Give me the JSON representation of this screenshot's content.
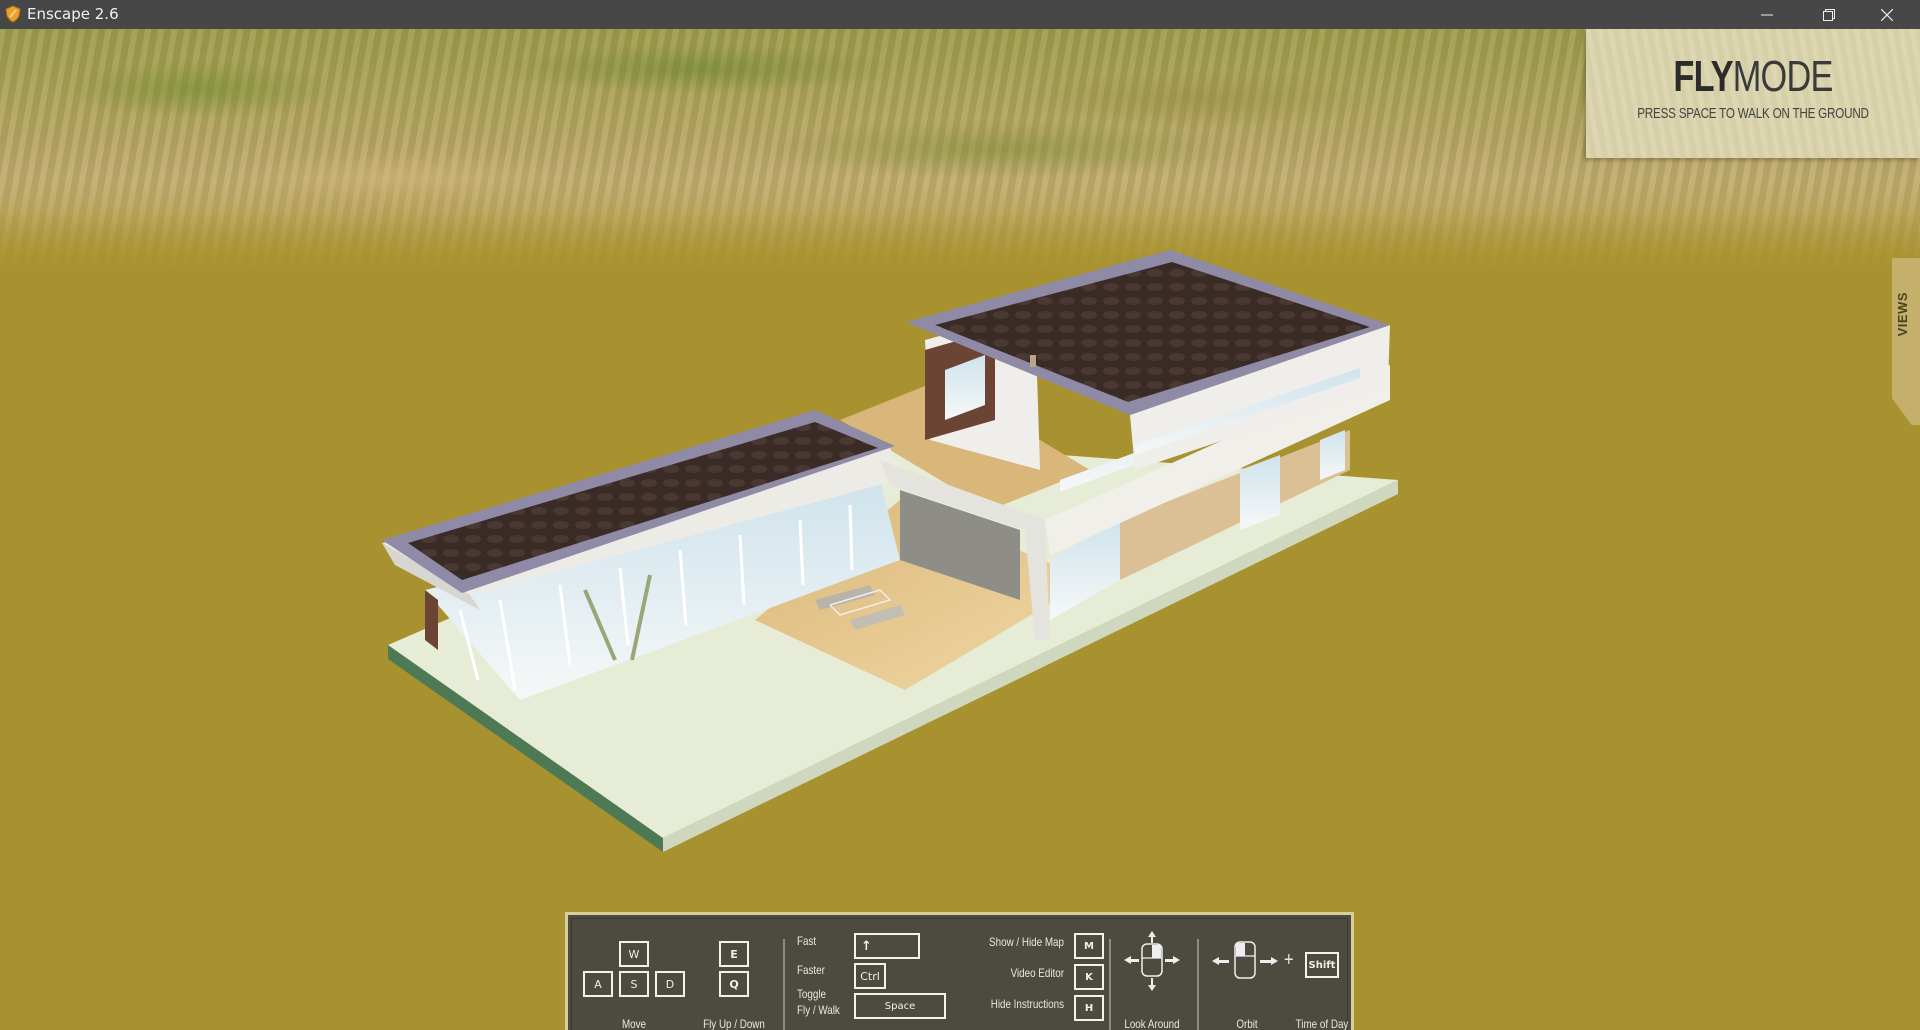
{
  "window": {
    "title": "Enscape 2.6",
    "controls": {
      "minimize": "minimize-icon",
      "restore": "restore-icon",
      "close": "close-icon"
    }
  },
  "overlay": {
    "mode_bold": "FLY",
    "mode_light": "MODE",
    "hint": "PRESS SPACE TO WALK ON THE GROUND",
    "views_tab": "VIEWS"
  },
  "instructions": {
    "move": {
      "keys": [
        "W",
        "A",
        "S",
        "D"
      ],
      "label": "Move"
    },
    "fly": {
      "keys": [
        "E",
        "Q"
      ],
      "label": "Fly Up / Down"
    },
    "fast": {
      "label": "Fast",
      "key": "↑",
      "key_icon": "shift-arrow-icon"
    },
    "faster": {
      "label": "Faster",
      "key": "Ctrl"
    },
    "toggle": {
      "label_line1": "Toggle",
      "label_line2": "Fly / Walk",
      "key": "Space"
    },
    "map": {
      "label": "Show / Hide Map",
      "key": "M"
    },
    "video": {
      "label": "Video Editor",
      "key": "K"
    },
    "hide": {
      "label": "Hide Instructions",
      "key": "H"
    },
    "look": {
      "label": "Look Around",
      "icon": "mouse-look-icon"
    },
    "orbit": {
      "label": "Orbit",
      "icon": "mouse-orbit-icon",
      "plus": "+"
    },
    "time": {
      "label": "Time of Day",
      "key": "Shift"
    }
  },
  "colors": {
    "titlebar": "#474747",
    "ground": "#a8922f",
    "panel_bg": "#4d4b40",
    "panel_border": "#d9cd99",
    "roof": "#3b2c28",
    "wall": "#ecebe6",
    "brick": "#6b4434",
    "plate": "#e6ecd6",
    "plate_edge": "#4f7a56"
  }
}
